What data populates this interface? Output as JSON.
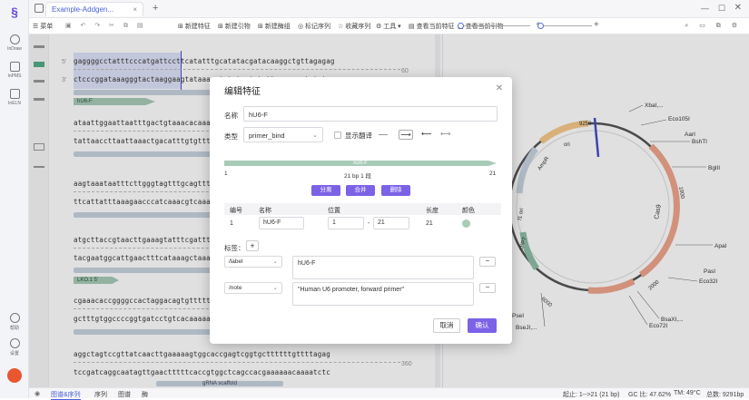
{
  "app": {
    "tab_title": "Example-Addgen...",
    "sidebar": [
      {
        "label": "InDraw"
      },
      {
        "label": "InPMS"
      },
      {
        "label": "InELN"
      },
      {
        "label": "帮助"
      },
      {
        "label": "设置"
      }
    ]
  },
  "toolbar": {
    "menu_label": "菜单",
    "items": [
      "新建特征",
      "新建引物",
      "新建酶组",
      "标记序列",
      "收藏序列",
      "工具",
      "查看当前特征",
      "查看当前引物"
    ]
  },
  "sequence": {
    "lines": [
      {
        "num_left": "5'",
        "top": "gaggggcctatttcccatgattccttcatatttgcatatacgatacaaggctgttagagag",
        "bottom": "ctcccggataaagggtactaaggaagtataaacgtatatgctatgttccgacaatctctc",
        "num_right": "60"
      },
      {
        "top": "ataattggaattaatttgactgtaaacacaaagatattagtacaaaatacgtgacgtaga",
        "bottom": "tattaaccttaattaaactgacatttgtgtttctataatcatgttttatgcactgcatct"
      },
      {
        "top": "aagtaaataatttcttgggtagtttgcagttttaaaattatgttttaaaatggactatca",
        "bottom": "ttcattatttaaagaacccatcaaacgtcaaaattttaatacaaaattttacctgatagt"
      },
      {
        "top": "atgcttaccgtaacttgaaagtatttcgatttcttggctttatatatcttgtggaaagga",
        "bottom": "tacgaatggcattgaactttcataaagctaaagaaccgaaatatatagaacacctttcct"
      },
      {
        "top": "cgaaacaccggggccactaggacagtgtttttgaagagcatttttgactgtgaatacgtt",
        "bottom": "gctttgtggccccggtgatcctgtcacaaaaacttctcgtaaaaactgacacttatgcaa"
      },
      {
        "top": "aggctagtccgttatcaacttgaaaaagtggcaccgagtcggtgcttttttgttttagag",
        "bottom": "tccgatcaggcaatagttgaactttttcaccgtggctcagccacgaaaaaacaaaatctc",
        "num_right": "360"
      }
    ],
    "features": [
      {
        "label": "hU6-F"
      },
      {
        "label": "LKO.1 5'"
      },
      {
        "label": "gRNA scaffold"
      }
    ],
    "letters_u": "U"
  },
  "plasmid_map": {
    "site_labels": [
      "XbaI,...",
      "Eco105I",
      "AarI",
      "BshTI",
      "BglII",
      "ApaI",
      "PasI",
      "Eco32I",
      "BsaXI,...",
      "Eco72I",
      "BseJI,...",
      "PseI"
    ],
    "feature_labels": [
      "Cas9",
      "cPPT",
      "ori",
      "f1 ori",
      "AmpR",
      "Puro"
    ],
    "position_labels": [
      "9250",
      "1000",
      "2000",
      "3000",
      "6000",
      "5000",
      "4000"
    ]
  },
  "dialog": {
    "title": "编辑特征",
    "name_label": "名称",
    "name_value": "hU6-F",
    "type_label": "类型",
    "type_value": "primer_bind",
    "show_translation_label": "显示翻译",
    "preview_label": "hU6-F",
    "preview_start": "1",
    "preview_end": "21",
    "preview_info": "21 bp  1 段",
    "split_button": "分离",
    "merge_button": "合并",
    "delete_button": "删除",
    "table_headers": [
      "编号",
      "名称",
      "位置",
      "长度",
      "颜色"
    ],
    "rows": [
      {
        "index": "1",
        "name": "hU6-F",
        "start": "1",
        "sep": "-",
        "end": "21",
        "length": "21",
        "color": "#a8cbb8"
      }
    ],
    "tags_label": "标签：",
    "tag_add": "+",
    "qualifiers": [
      {
        "key": "/label",
        "value": "hU6-F"
      },
      {
        "key": "/note",
        "value": "\"Human U6 promoter, forward primer\""
      }
    ],
    "cancel_button": "取消",
    "confirm_button": "确认"
  },
  "status": {
    "tabs": [
      "图谱&序列",
      "序列",
      "图谱",
      "酶"
    ],
    "selection": "起止: 1-->21 (21 bp)",
    "gc": "GC 比: 47.62%",
    "tm": "TM: 49°C",
    "total": "总数: 9291bp"
  },
  "colors": {
    "accent": "#7b62e6",
    "link": "#4a62d8",
    "primer_green": "#a8cbb8",
    "cas9_orange": "#f0a58c",
    "selection": "#c4ccf5",
    "map_line": "#4a4acc"
  }
}
